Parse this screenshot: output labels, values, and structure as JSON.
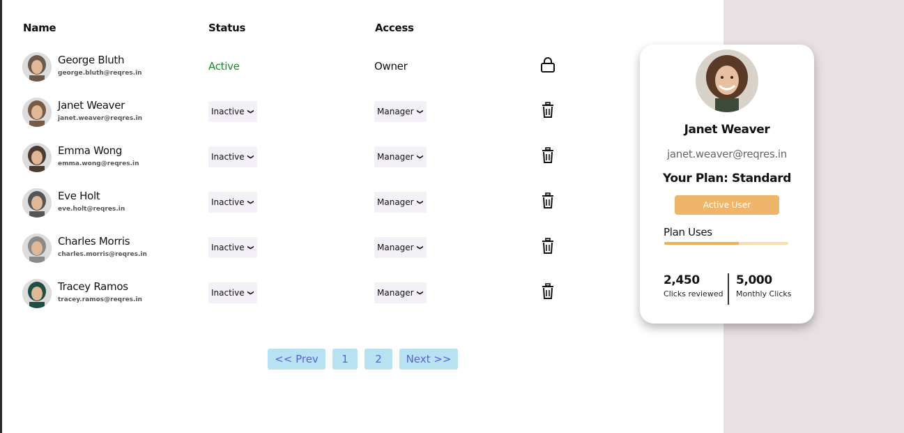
{
  "table": {
    "headers": {
      "name": "Name",
      "status": "Status",
      "access": "Access"
    },
    "rows": [
      {
        "name": "George Bluth",
        "email": "george.bluth@reqres.in",
        "status": "Active",
        "access": "Owner",
        "action_icon": "lock-icon",
        "avatar_color": "#6b5a4a"
      },
      {
        "name": "Janet Weaver",
        "email": "janet.weaver@reqres.in",
        "status": "Inactive",
        "access": "Manager",
        "action_icon": "trash-icon",
        "avatar_color": "#7a5a44"
      },
      {
        "name": "Emma Wong",
        "email": "emma.wong@reqres.in",
        "status": "Inactive",
        "access": "Manager",
        "action_icon": "trash-icon",
        "avatar_color": "#4b3b32"
      },
      {
        "name": "Eve Holt",
        "email": "eve.holt@reqres.in",
        "status": "Inactive",
        "access": "Manager",
        "action_icon": "trash-icon",
        "avatar_color": "#555555"
      },
      {
        "name": "Charles Morris",
        "email": "charles.morris@reqres.in",
        "status": "Inactive",
        "access": "Manager",
        "action_icon": "trash-icon",
        "avatar_color": "#8a8a8a"
      },
      {
        "name": "Tracey Ramos",
        "email": "tracey.ramos@reqres.in",
        "status": "Inactive",
        "access": "Manager",
        "action_icon": "trash-icon",
        "avatar_color": "#1f4e44"
      }
    ]
  },
  "pagination": {
    "prev": "<< Prev",
    "page1": "1",
    "page2": "2",
    "next": "Next >>"
  },
  "card": {
    "name": "Janet Weaver",
    "email": "janet.weaver@reqres.in",
    "plan": "Your Plan: Standard",
    "status_button": "Active User",
    "uses_label": "Plan Uses",
    "uses_fraction": 0.6,
    "stat1": {
      "value": "2,450",
      "label": "Clicks reviewed"
    },
    "stat2": {
      "value": "5,000",
      "label": "Monthly Clicks"
    }
  },
  "colors": {
    "active_green": "#1a8a2a",
    "accent_orange": "#efb56a",
    "pager_bg": "#b7e2f2",
    "pager_text": "#5a5fd6",
    "side_bg": "#e8e0e2"
  }
}
